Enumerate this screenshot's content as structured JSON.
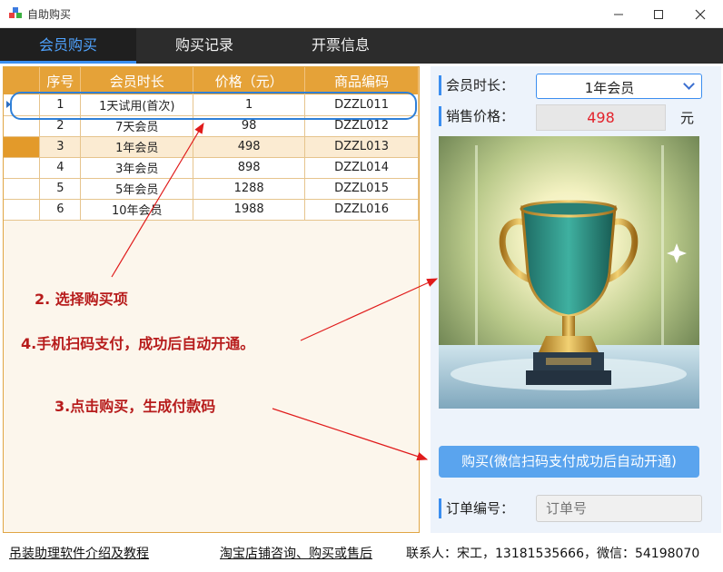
{
  "window": {
    "title": "自助购买",
    "icons": [
      "app-icon",
      "minimize-icon",
      "maximize-icon",
      "close-icon"
    ]
  },
  "tabs": [
    {
      "label": "会员购买",
      "active": true
    },
    {
      "label": "购买记录",
      "active": false
    },
    {
      "label": "开票信息",
      "active": false
    }
  ],
  "grid": {
    "columns": [
      "序号",
      "会员时长",
      "价格（元）",
      "商品编码"
    ],
    "rows": [
      {
        "no": "1",
        "duration": "1天试用(首次)",
        "price": "1",
        "code": "DZZL011"
      },
      {
        "no": "2",
        "duration": "7天会员",
        "price": "98",
        "code": "DZZL012"
      },
      {
        "no": "3",
        "duration": "1年会员",
        "price": "498",
        "code": "DZZL013"
      },
      {
        "no": "4",
        "duration": "3年会员",
        "price": "898",
        "code": "DZZL014"
      },
      {
        "no": "5",
        "duration": "5年会员",
        "price": "1288",
        "code": "DZZL015"
      },
      {
        "no": "6",
        "duration": "10年会员",
        "price": "1988",
        "code": "DZZL016"
      }
    ],
    "selected_row": 3
  },
  "form": {
    "duration_label": "会员时长：",
    "duration_value": "1年会员",
    "price_label": "销售价格：",
    "price_value": "498",
    "price_unit": "元",
    "buy_button": "购买(微信扫码支付成功后自动开通)",
    "order_label": "订单编号：",
    "order_placeholder": "订单号"
  },
  "annotations": {
    "step2": "2. 选择购买项",
    "step4": "4.手机扫码支付，成功后自动开通。",
    "step3": "3.点击购买，生成付款码",
    "color": "#b71c1c"
  },
  "footer": {
    "intro_link": "吊装助理软件介绍及教程",
    "shop_link": "淘宝店铺咨询、购买或售后",
    "contact": "联系人：宋工，13181535666，微信：54198070"
  },
  "colors": {
    "accent": "#3b8ef0",
    "grid_header": "#e5a238",
    "price": "#e3232c",
    "tabbar": "#2c2c2c"
  }
}
